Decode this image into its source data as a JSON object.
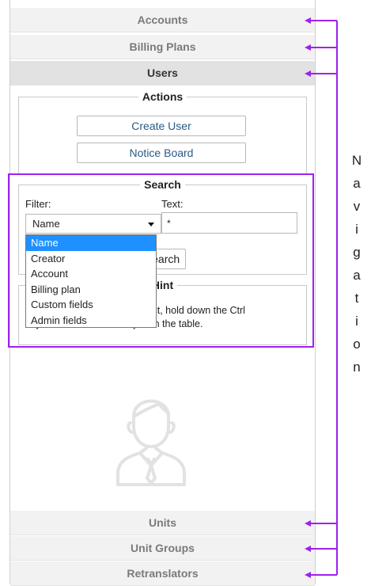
{
  "nav_top": [
    "Accounts",
    "Billing Plans",
    "Users"
  ],
  "nav_bottom": [
    "Units",
    "Unit Groups",
    "Retranslators"
  ],
  "actions": {
    "legend": "Actions",
    "buttons": [
      "Create User",
      "Notice Board"
    ]
  },
  "search": {
    "legend": "Search",
    "filter_label": "Filter:",
    "filter_value": "Name",
    "text_label": "Text:",
    "text_value": "*",
    "search_button": "Search",
    "options": [
      "Name",
      "Creator",
      "Account",
      "Billing plan",
      "Custom fields",
      "Admin fields"
    ]
  },
  "hint": {
    "legend": "Hint",
    "line1": "To select more than one object, hold down the Ctrl",
    "line2": "key and click on each object in the table."
  },
  "annotation": {
    "letters": [
      "N",
      "a",
      "v",
      "i",
      "g",
      "a",
      "t",
      "i",
      "o",
      "n"
    ],
    "color": "#a020f0"
  }
}
